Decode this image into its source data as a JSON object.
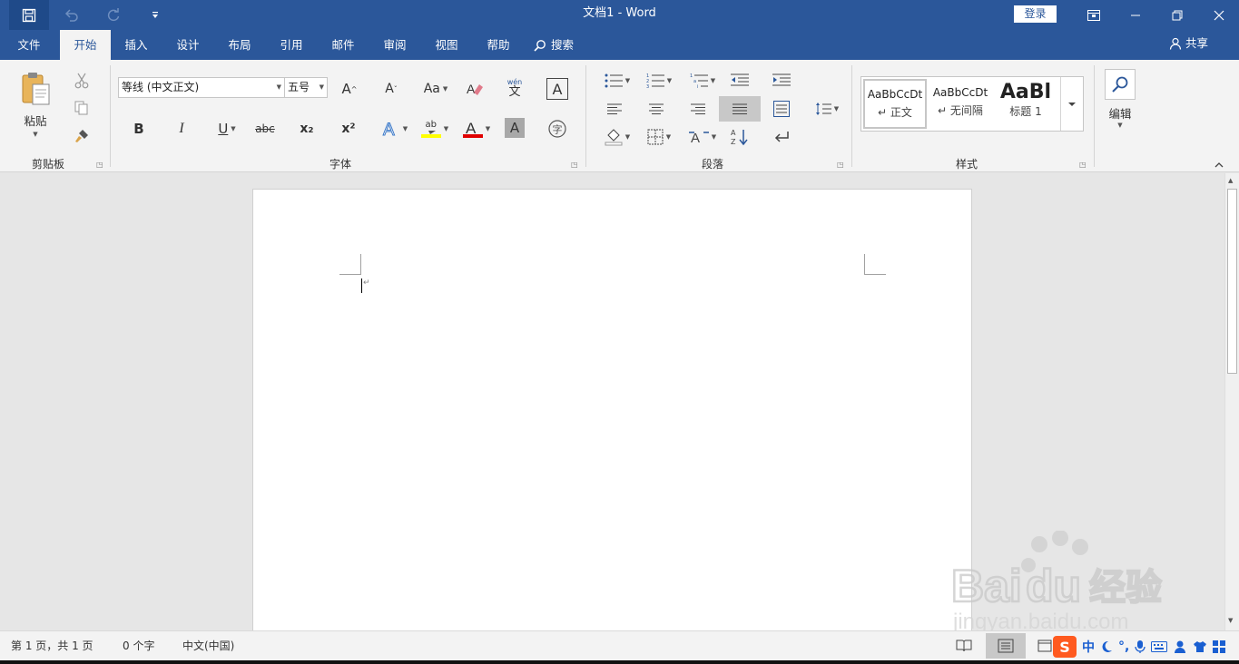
{
  "app": {
    "title": "文档1  -  Word",
    "login_label": "登录"
  },
  "tabs": [
    {
      "label": "文件",
      "active": false
    },
    {
      "label": "开始",
      "active": true
    },
    {
      "label": "插入",
      "active": false
    },
    {
      "label": "设计",
      "active": false
    },
    {
      "label": "布局",
      "active": false
    },
    {
      "label": "引用",
      "active": false
    },
    {
      "label": "邮件",
      "active": false
    },
    {
      "label": "审阅",
      "active": false
    },
    {
      "label": "视图",
      "active": false
    },
    {
      "label": "帮助",
      "active": false
    }
  ],
  "search_label": "搜索",
  "share_label": "共享",
  "clipboard": {
    "paste_label": "粘贴",
    "group_label": "剪贴板"
  },
  "font": {
    "font_name": "等线 (中文正文)",
    "font_size": "五号",
    "group_label": "字体",
    "bold": "B",
    "italic": "I",
    "underline": "U",
    "strikethrough": "abc",
    "subscript": "x₂",
    "superscript": "x²",
    "change_case": "Aa",
    "phonetic": "wén",
    "highlight_text": "ab"
  },
  "paragraph": {
    "group_label": "段落"
  },
  "styles": {
    "group_label": "样式",
    "items": [
      {
        "sample": "AaBbCcDt",
        "name": "正文"
      },
      {
        "sample": "AaBbCcDt",
        "name": "无间隔"
      },
      {
        "sample": "AaBl",
        "name": "标题 1"
      }
    ]
  },
  "editing": {
    "label": "编辑"
  },
  "status": {
    "page": "第 1 页，共 1 页",
    "words": "0 个字",
    "language": "中文(中国)"
  },
  "ime": {
    "mode_label": "中"
  },
  "colors": {
    "accent": "#2b579a",
    "highlight": "#ffff00",
    "font_color": "#e00000"
  }
}
